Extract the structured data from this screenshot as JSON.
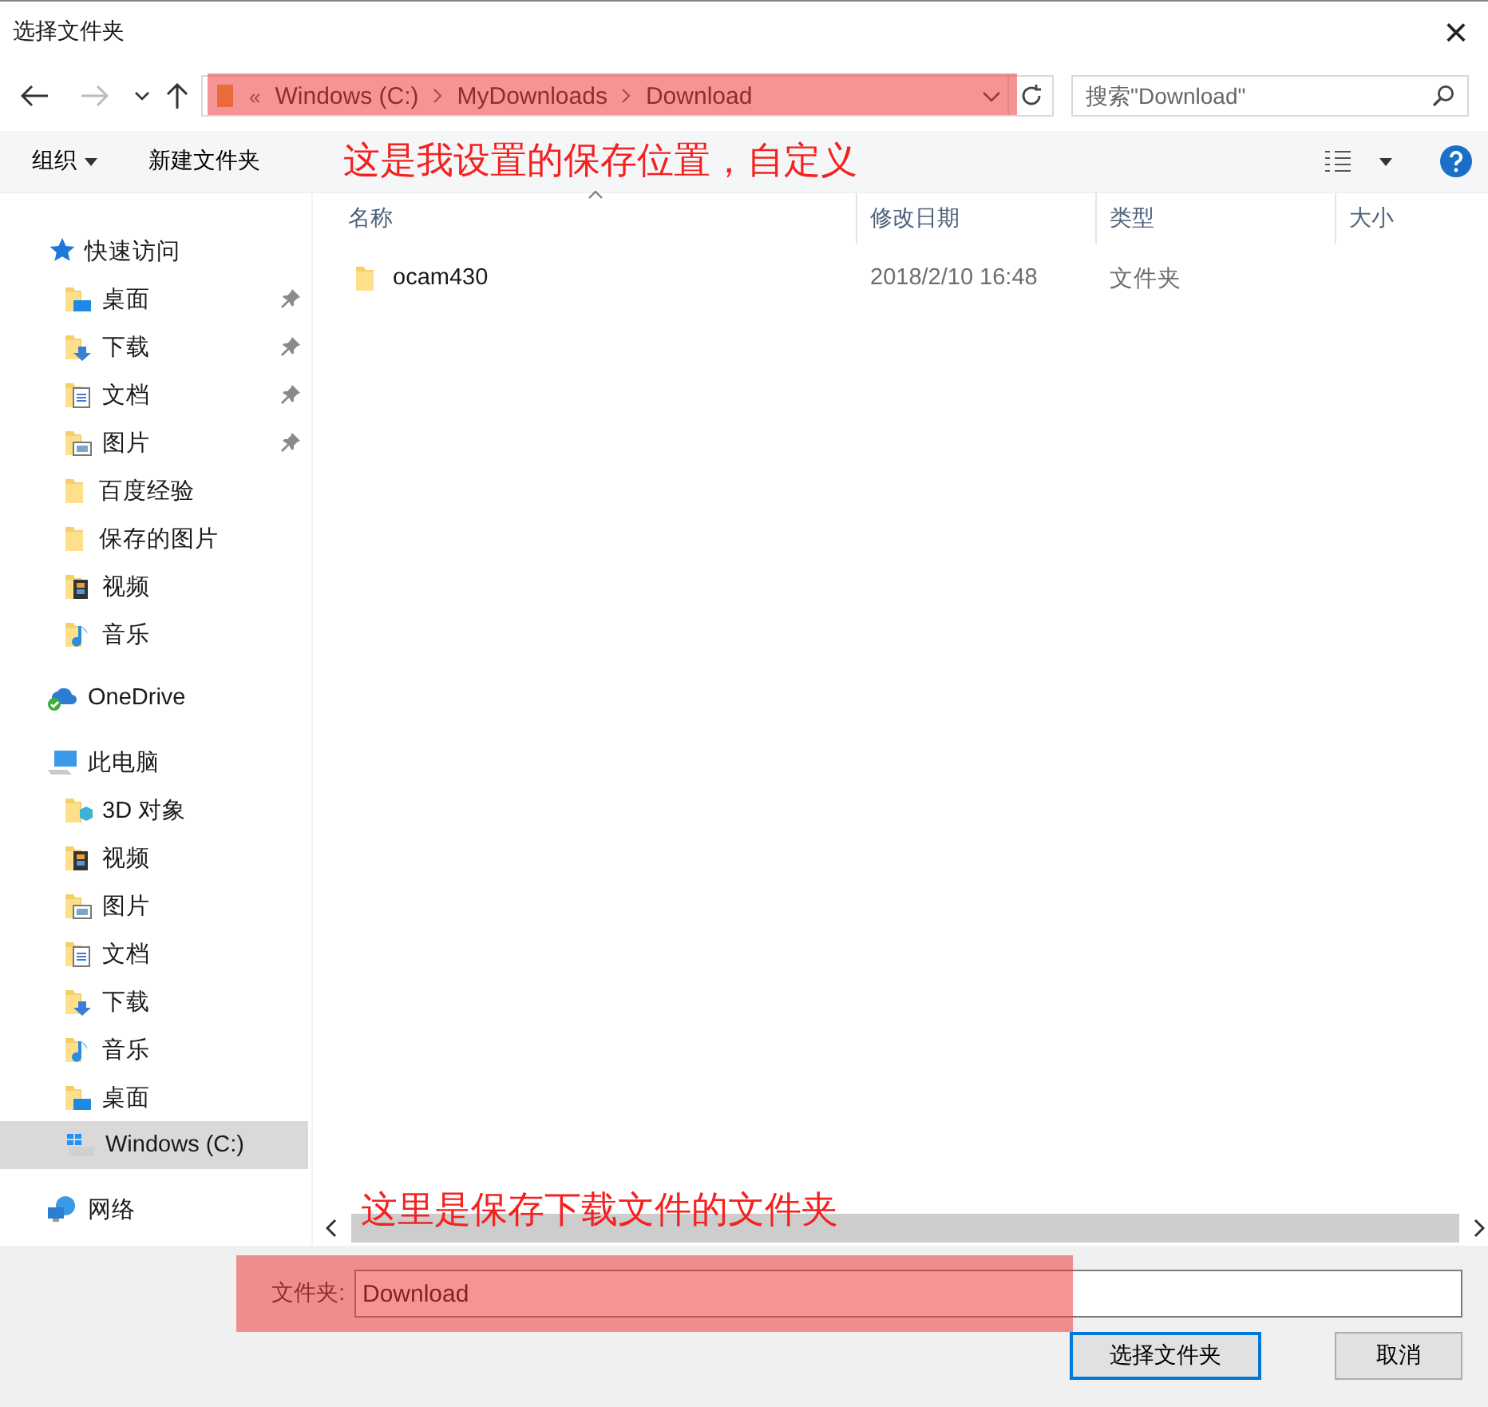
{
  "window": {
    "title": "选择文件夹",
    "close": "×"
  },
  "address_bar": {
    "path": [
      {
        "label": "Windows (C:)"
      },
      {
        "label": "MyDownloads"
      },
      {
        "label": "Download"
      }
    ],
    "overflow": "«",
    "back_disabled": false,
    "forward_disabled": true
  },
  "search": {
    "placeholder": "搜索\"Download\""
  },
  "toolbar": {
    "organize": "组织",
    "new_folder": "新建文件夹"
  },
  "sidebar": {
    "items": [
      {
        "label": "快速访问",
        "kind": "star",
        "selected": false,
        "children": [
          {
            "label": "桌面",
            "kind": "desktop",
            "pinned": true,
            "selected": false
          },
          {
            "label": "下载",
            "kind": "downloads",
            "pinned": true,
            "selected": false
          },
          {
            "label": "文档",
            "kind": "documents",
            "pinned": true,
            "selected": false
          },
          {
            "label": "图片",
            "kind": "pictures",
            "pinned": true,
            "selected": false
          },
          {
            "label": "百度经验",
            "kind": "folder",
            "pinned": false,
            "selected": false
          },
          {
            "label": "保存的图片",
            "kind": "folder",
            "pinned": false,
            "selected": false
          },
          {
            "label": "视频",
            "kind": "videos",
            "pinned": false,
            "selected": false
          },
          {
            "label": "音乐",
            "kind": "music",
            "pinned": false,
            "selected": false
          }
        ]
      },
      {
        "label": "OneDrive",
        "kind": "cloud",
        "selected": false
      },
      {
        "label": "此电脑",
        "kind": "computer",
        "selected": false,
        "children": [
          {
            "label": "3D 对象",
            "kind": "objects3d",
            "pinned": false,
            "selected": false
          },
          {
            "label": "视频",
            "kind": "videos",
            "pinned": false,
            "selected": false
          },
          {
            "label": "图片",
            "kind": "pictures",
            "pinned": false,
            "selected": false
          },
          {
            "label": "文档",
            "kind": "documents",
            "pinned": false,
            "selected": false
          },
          {
            "label": "下载",
            "kind": "downloads",
            "pinned": false,
            "selected": false
          },
          {
            "label": "音乐",
            "kind": "music",
            "pinned": false,
            "selected": false
          },
          {
            "label": "桌面",
            "kind": "desktop",
            "pinned": false,
            "selected": false
          },
          {
            "label": "Windows (C:)",
            "kind": "drive",
            "pinned": false,
            "selected": true
          }
        ]
      },
      {
        "label": "网络",
        "kind": "network",
        "selected": false
      }
    ]
  },
  "table": {
    "columns": [
      {
        "label": "名称",
        "sorted": true
      },
      {
        "label": "修改日期",
        "sorted": false
      },
      {
        "label": "类型",
        "sorted": false
      },
      {
        "label": "大小",
        "sorted": false
      }
    ],
    "rows": [
      {
        "name": "ocam430",
        "modified": "2018/2/10 16:48",
        "type": "文件夹",
        "selected": false
      }
    ]
  },
  "footer": {
    "folder_label": "文件夹:",
    "folder_value": "Download",
    "buttons": [
      {
        "label": "选择文件夹",
        "default": true
      },
      {
        "label": "取消",
        "default": false
      }
    ]
  },
  "annotations": [
    {
      "text": "这是我设置的保存位置，自定义"
    },
    {
      "text": "这里是保存下载文件的文件夹"
    }
  ]
}
